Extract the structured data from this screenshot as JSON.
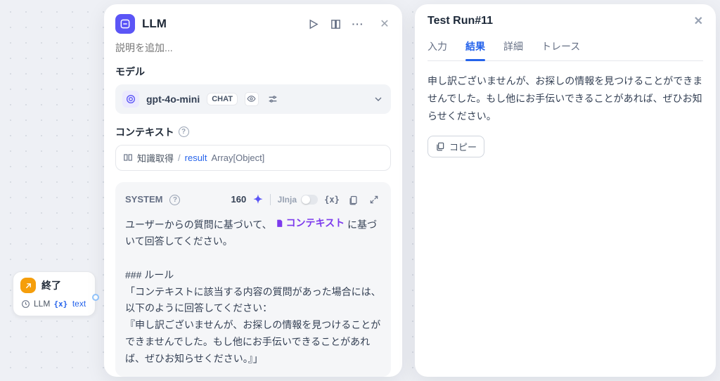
{
  "canvas": {
    "node_end": {
      "title": "終了",
      "llm_label": "LLM",
      "var_name": "text"
    }
  },
  "llm_panel": {
    "title": "LLM",
    "desc_placeholder": "説明を追加...",
    "model_section_label": "モデル",
    "model": {
      "name": "gpt-4o-mini",
      "chat_badge": "CHAT"
    },
    "context_label": "コンテキスト",
    "context_chip": {
      "retriever": "知識取得",
      "separator": "/",
      "result_label": "result",
      "type": "Array[Object]"
    },
    "system": {
      "role_label": "SYSTEM",
      "token_count": "160",
      "jinja_label": "JInja",
      "var_icon_label": "{x}",
      "body_before_chip": "ユーザーからの質問に基づいて、",
      "chip_text": "コンテキスト",
      "body_after_chip": " に基づいて回答してください。",
      "rule_heading": "### ルール",
      "rule_line1": "「コンテキストに該当する内容の質問があった場合には、以下のように回答してください：",
      "rule_line2": "『申し訳ございませんが、お探しの情報を見つけることができませんでした。もし他にお手伝いできることがあれば、ぜひお知らせください。』」"
    }
  },
  "run_panel": {
    "title": "Test Run#11",
    "tabs": {
      "input": "入力",
      "result": "結果",
      "detail": "詳細",
      "trace": "トレース"
    },
    "active_tab": "result",
    "body": "申し訳ございませんが、お探しの情報を見つけることができませんでした。もし他にお手伝いできることがあれば、ぜひお知らせください。",
    "copy_label": "コピー"
  }
}
